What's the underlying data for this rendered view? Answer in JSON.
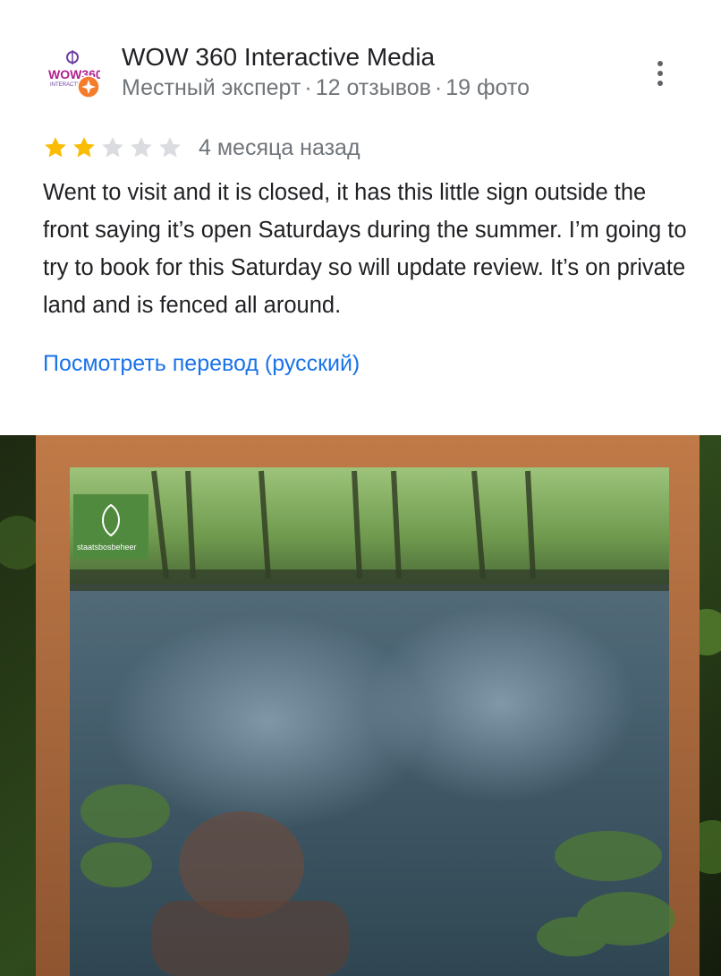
{
  "review": {
    "author": {
      "name": "WOW 360 Interactive Media",
      "avatar_text": "WOW360",
      "avatar_subtext": "INTERACTIVE",
      "badge_icon": "local-guide-star-icon",
      "level": "Местный эксперт",
      "reviews": "12 отзывов",
      "photos": "19 фото",
      "separator": "·"
    },
    "menu_icon": "more-vert-icon",
    "rating": 2,
    "rating_max": 5,
    "time": "4 месяца назад",
    "text": "Went to visit and it is closed, it has this little sign outside the front saying it’s open Saturdays during the summer. I’m going to try to book for this Saturday so will update review. It’s on private land and is fenced all around.",
    "translate_link": "Посмотреть перевод (русский)",
    "photo": {
      "sign_logo_text": "staatsbosbeheer"
    }
  },
  "colors": {
    "name": "#202124",
    "meta": "#70757a",
    "star_filled": "#fbbc04",
    "star_empty": "#dadce0",
    "link": "#1a73e8",
    "badge": "#f57c2d",
    "frame": "#a86a3e"
  }
}
